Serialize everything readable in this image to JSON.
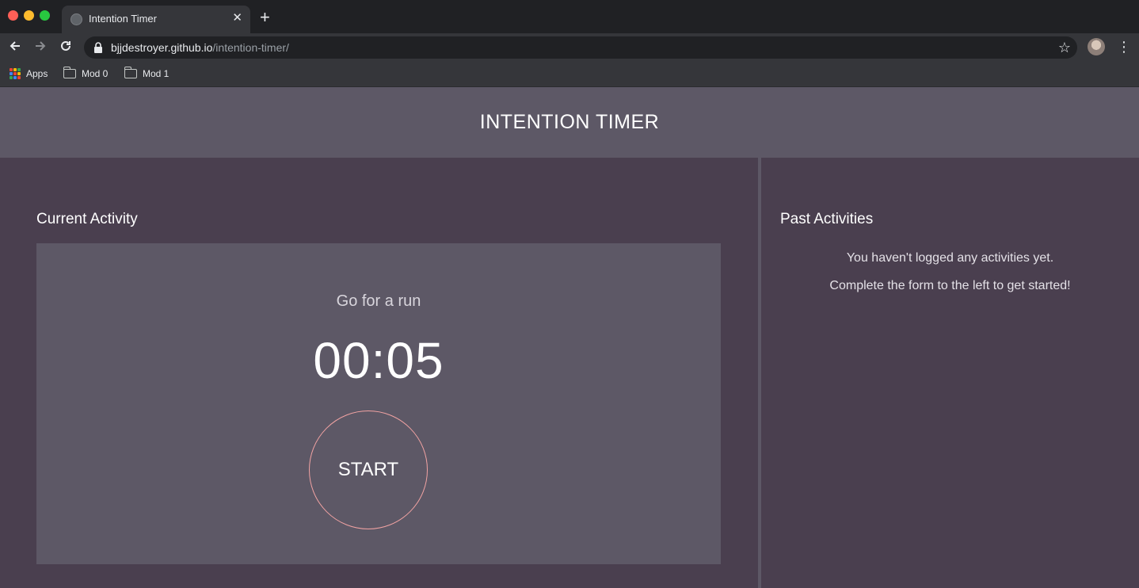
{
  "browser": {
    "tab_title": "Intention Timer",
    "tab_close": "✕",
    "new_tab": "+",
    "url_host": "bjjdestroyer.github.io",
    "url_path": "/intention-timer/",
    "bookmarks": [
      {
        "label": "Apps",
        "icon": "apps-grid-icon"
      },
      {
        "label": "Mod 0",
        "icon": "folder-icon"
      },
      {
        "label": "Mod 1",
        "icon": "folder-icon"
      }
    ]
  },
  "page": {
    "title": "INTENTION TIMER",
    "current": {
      "heading": "Current Activity",
      "description": "Go for a run",
      "timer": "00:05",
      "start_label": "START",
      "ring_color": "#f2a3a3"
    },
    "past": {
      "heading": "Past Activities",
      "empty_line_1": "You haven't logged any activities yet.",
      "empty_line_2": "Complete the form to the left to get started!"
    }
  },
  "colors": {
    "header_bg": "#5d5866",
    "panel_bg": "#4a3f4f",
    "card_bg": "#5d5866"
  }
}
